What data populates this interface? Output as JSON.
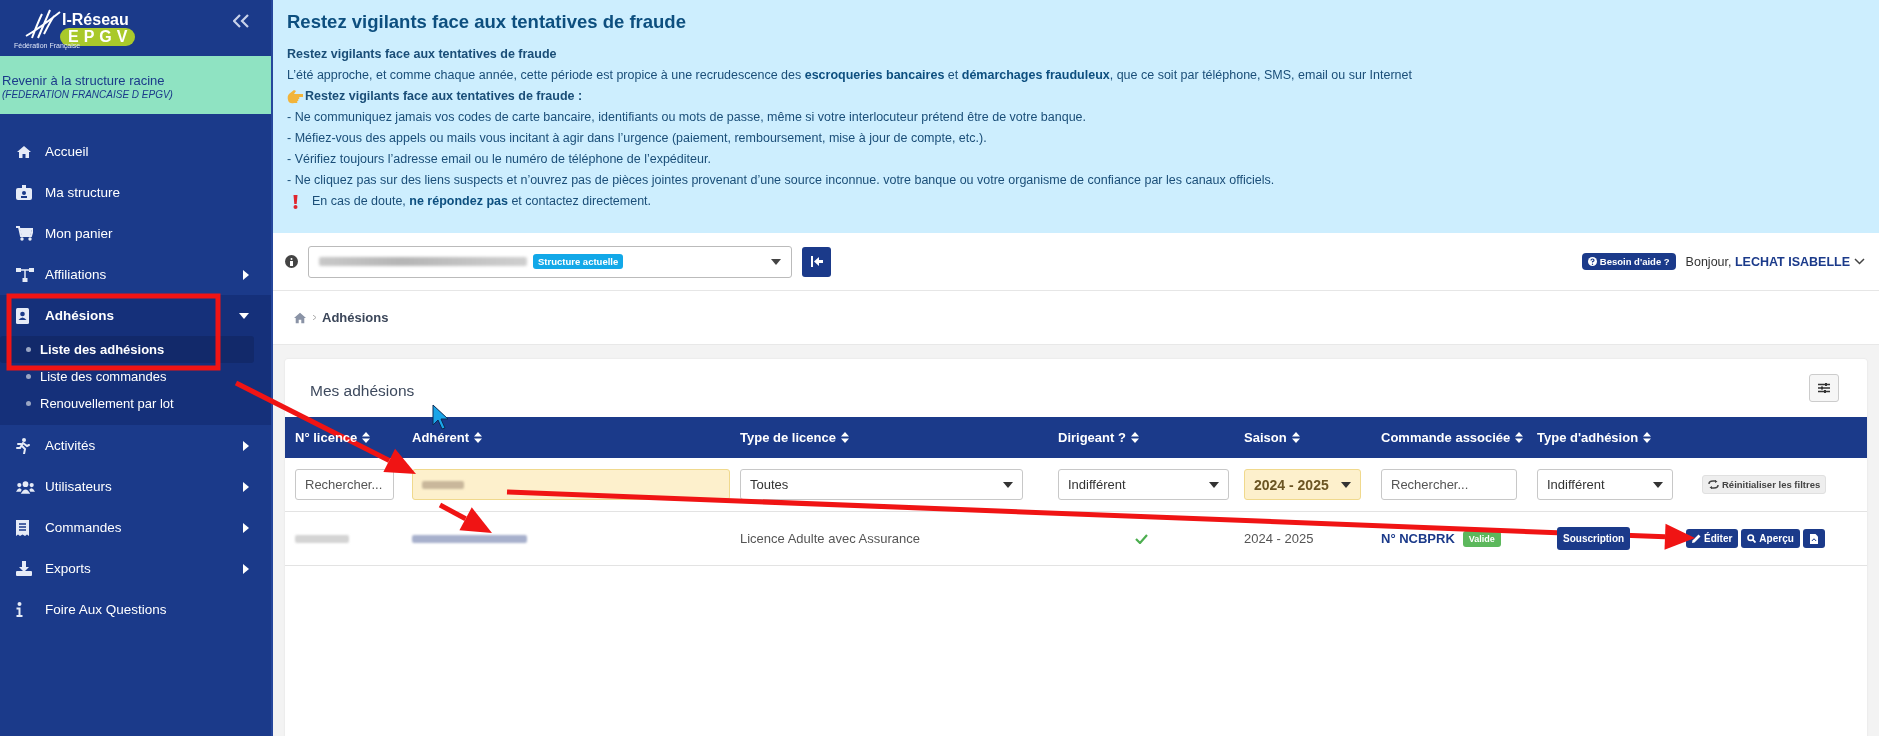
{
  "sidebar": {
    "logo": {
      "title": "I-Réseau",
      "badge": "EPGV",
      "caption": "Fédération Française"
    },
    "root_link": {
      "title": "Revenir à la structure racine",
      "subtitle": "(FEDERATION FRANCAISE D EPGV)"
    },
    "items": [
      {
        "label": "Accueil",
        "kind": "link"
      },
      {
        "label": "Ma structure",
        "kind": "link"
      },
      {
        "label": "Mon panier",
        "kind": "link"
      },
      {
        "label": "Affiliations",
        "kind": "group",
        "expanded": false
      },
      {
        "label": "Adhésions",
        "kind": "group",
        "expanded": true,
        "children": [
          {
            "label": "Liste des adhésions",
            "selected": true
          },
          {
            "label": "Liste des commandes",
            "selected": false
          },
          {
            "label": "Renouvellement par lot",
            "selected": false
          }
        ]
      },
      {
        "label": "Activités",
        "kind": "group",
        "expanded": false
      },
      {
        "label": "Utilisateurs",
        "kind": "group",
        "expanded": false
      },
      {
        "label": "Commandes",
        "kind": "group",
        "expanded": false
      },
      {
        "label": "Exports",
        "kind": "group",
        "expanded": false
      },
      {
        "label": "Foire Aux Questions",
        "kind": "link"
      }
    ]
  },
  "banner": {
    "title": "Restez vigilants face aux tentatives de fraude",
    "lines": [
      {
        "kind": "heading",
        "text": "Restez vigilants face aux tentatives de fraude"
      },
      {
        "kind": "text",
        "text": "L’été approche, et comme chaque année, cette période est propice à une recrudescence des **escroqueries bancaires** et **démarchages frauduleux**, que ce soit par téléphone, SMS, email ou sur Internet"
      },
      {
        "kind": "pointer",
        "text": "Restez vigilants face aux tentatives de fraude :"
      },
      {
        "kind": "text",
        "text": "- Ne communiquez jamais vos codes de carte bancaire, identifiants ou mots de passe, même si votre interlocuteur prétend être de votre banque."
      },
      {
        "kind": "text",
        "text": "- Méfiez-vous des appels ou mails vous incitant à agir dans l’urgence (paiement, remboursement, mise à jour de compte, etc.)."
      },
      {
        "kind": "text",
        "text": "- Vérifiez toujours l’adresse email ou le numéro de téléphone de l’expéditeur."
      },
      {
        "kind": "text",
        "text": "- Ne cliquez pas sur des liens suspects et n’ouvrez pas de pièces jointes provenant d’une source inconnue. votre banque ou votre organisme de confiance par les canaux officiels."
      },
      {
        "kind": "alert",
        "text": "En cas de doute, **ne répondez pas** et contactez directement."
      }
    ]
  },
  "topbar": {
    "structure_badge": "Structure actuelle",
    "help": "Besoin d'aide ?",
    "greeting": "Bonjour, **LECHAT ISABELLE**"
  },
  "breadcrumb": {
    "current": "Adhésions"
  },
  "card": {
    "title": "Mes adhésions",
    "columns": [
      {
        "label": "N° licence",
        "sortable": true
      },
      {
        "label": "Adhérent",
        "sortable": true
      },
      {
        "label": "Type de licence",
        "sortable": true
      },
      {
        "label": "Dirigeant ?",
        "sortable": true
      },
      {
        "label": "Saison",
        "sortable": true
      },
      {
        "label": "Commande associée",
        "sortable": true
      },
      {
        "label": "Type d'adhésion",
        "sortable": true
      }
    ],
    "filters": [
      {
        "kind": "search",
        "placeholder": "Rechercher...",
        "active": false
      },
      {
        "kind": "redacted",
        "active": true
      },
      {
        "kind": "select",
        "value": "Toutes",
        "active": false
      },
      {
        "kind": "select",
        "value": "Indifférent",
        "active": false
      },
      {
        "kind": "select",
        "value": "2024 - 2025",
        "active": true
      },
      {
        "kind": "search",
        "placeholder": "Rechercher...",
        "active": false
      },
      {
        "kind": "select",
        "value": "Indifférent",
        "active": false
      }
    ],
    "reset_button": "Réinitialiser les filtres",
    "rows": [
      {
        "cells": [
          {
            "kind": "redacted"
          },
          {
            "kind": "redacted"
          },
          {
            "kind": "text",
            "text": "Licence Adulte avec Assurance"
          },
          {
            "kind": "check",
            "checked": true
          },
          {
            "kind": "text",
            "text": "2024 - 2025"
          },
          {
            "kind": "order",
            "text": "N° NCBPRK",
            "badge": "Valide"
          },
          {
            "kind": "button",
            "text": "Souscription"
          },
          {
            "kind": "actions",
            "buttons": [
              {
                "kind": "edit",
                "label": "Éditer"
              },
              {
                "kind": "view",
                "label": "Aperçu"
              },
              {
                "kind": "pdf"
              }
            ]
          }
        ]
      }
    ]
  }
}
